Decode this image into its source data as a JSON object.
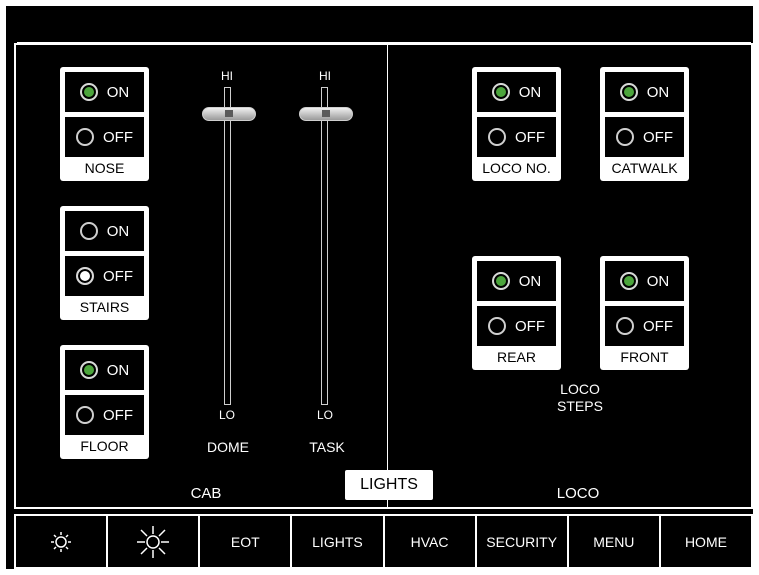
{
  "cab": {
    "label": "CAB",
    "switches": [
      {
        "name": "NOSE",
        "on": "ON",
        "off": "OFF",
        "state": "on"
      },
      {
        "name": "STAIRS",
        "on": "ON",
        "off": "OFF",
        "state": "off"
      },
      {
        "name": "FLOOR",
        "on": "ON",
        "off": "OFF",
        "state": "on"
      }
    ],
    "sliders": [
      {
        "name": "DOME",
        "hi": "HI",
        "lo": "LO",
        "level": 1.0
      },
      {
        "name": "TASK",
        "hi": "HI",
        "lo": "LO",
        "level": 1.0
      }
    ]
  },
  "loco": {
    "label": "LOCO",
    "switches": [
      {
        "name": "LOCO NO.",
        "on": "ON",
        "off": "OFF",
        "state": "on"
      },
      {
        "name": "CATWALK",
        "on": "ON",
        "off": "OFF",
        "state": "on"
      },
      {
        "name": "REAR",
        "on": "ON",
        "off": "OFF",
        "state": "on"
      },
      {
        "name": "FRONT",
        "on": "ON",
        "off": "OFF",
        "state": "on"
      }
    ],
    "steps_label_line1": "LOCO",
    "steps_label_line2": "STEPS"
  },
  "screen_tag": "LIGHTS",
  "colors": {
    "led_on": "#4ca53c",
    "led_selected_off": "#ffffff",
    "background": "#000000"
  },
  "nav": {
    "icons": [
      "sun-dim-icon",
      "sun-bright-icon"
    ],
    "items": [
      "EOT",
      "LIGHTS",
      "HVAC",
      "SECURITY",
      "MENU",
      "HOME"
    ]
  }
}
